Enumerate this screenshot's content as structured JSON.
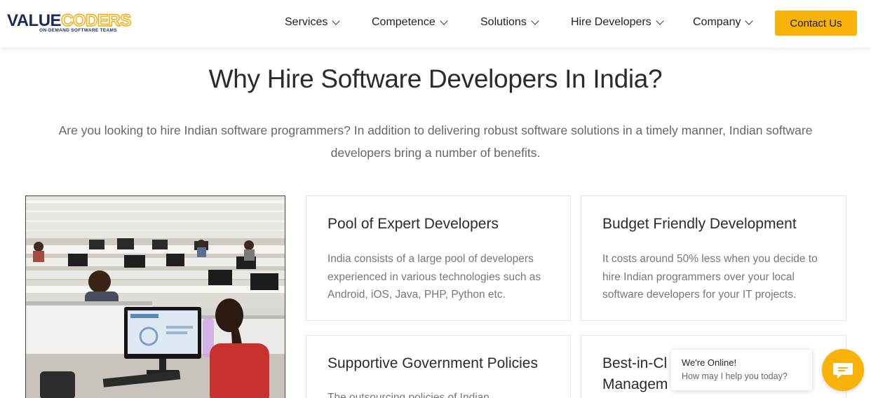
{
  "brand": {
    "logo_value": "VALUE",
    "logo_coders": "CODERS",
    "logo_tagline": "ON-DEMAND SOFTWARE TEAMS"
  },
  "nav": {
    "items": [
      {
        "label": "Services"
      },
      {
        "label": "Competence"
      },
      {
        "label": "Solutions"
      },
      {
        "label": "Hire Developers"
      },
      {
        "label": "Company"
      }
    ],
    "contact_label": "Contact Us"
  },
  "main": {
    "title": "Why Hire Software Developers In India?",
    "intro": "Are you looking to hire Indian software programmers? In addition to delivering robust software solutions in a timely manner, Indian software developers bring a number of benefits."
  },
  "cards": [
    {
      "title": "Pool of Expert Developers",
      "text": "India consists of a large pool of developers experienced in various technologies such as Android, iOS, Java, PHP, Python etc."
    },
    {
      "title": "Budget Friendly Development",
      "text": "It costs around 50% less when you decide to hire Indian programmers over your local software developers for your IT projects."
    },
    {
      "title": "Supportive Government Policies",
      "text": "The outsourcing policies of Indian"
    },
    {
      "title": "Best-in-Cl",
      "title2": "Managem",
      "text": ""
    }
  ],
  "chat": {
    "online": "We're Online!",
    "help": "How may I help you today?"
  },
  "colors": {
    "accent": "#f9b308",
    "brand_navy": "#1a2a5a"
  }
}
